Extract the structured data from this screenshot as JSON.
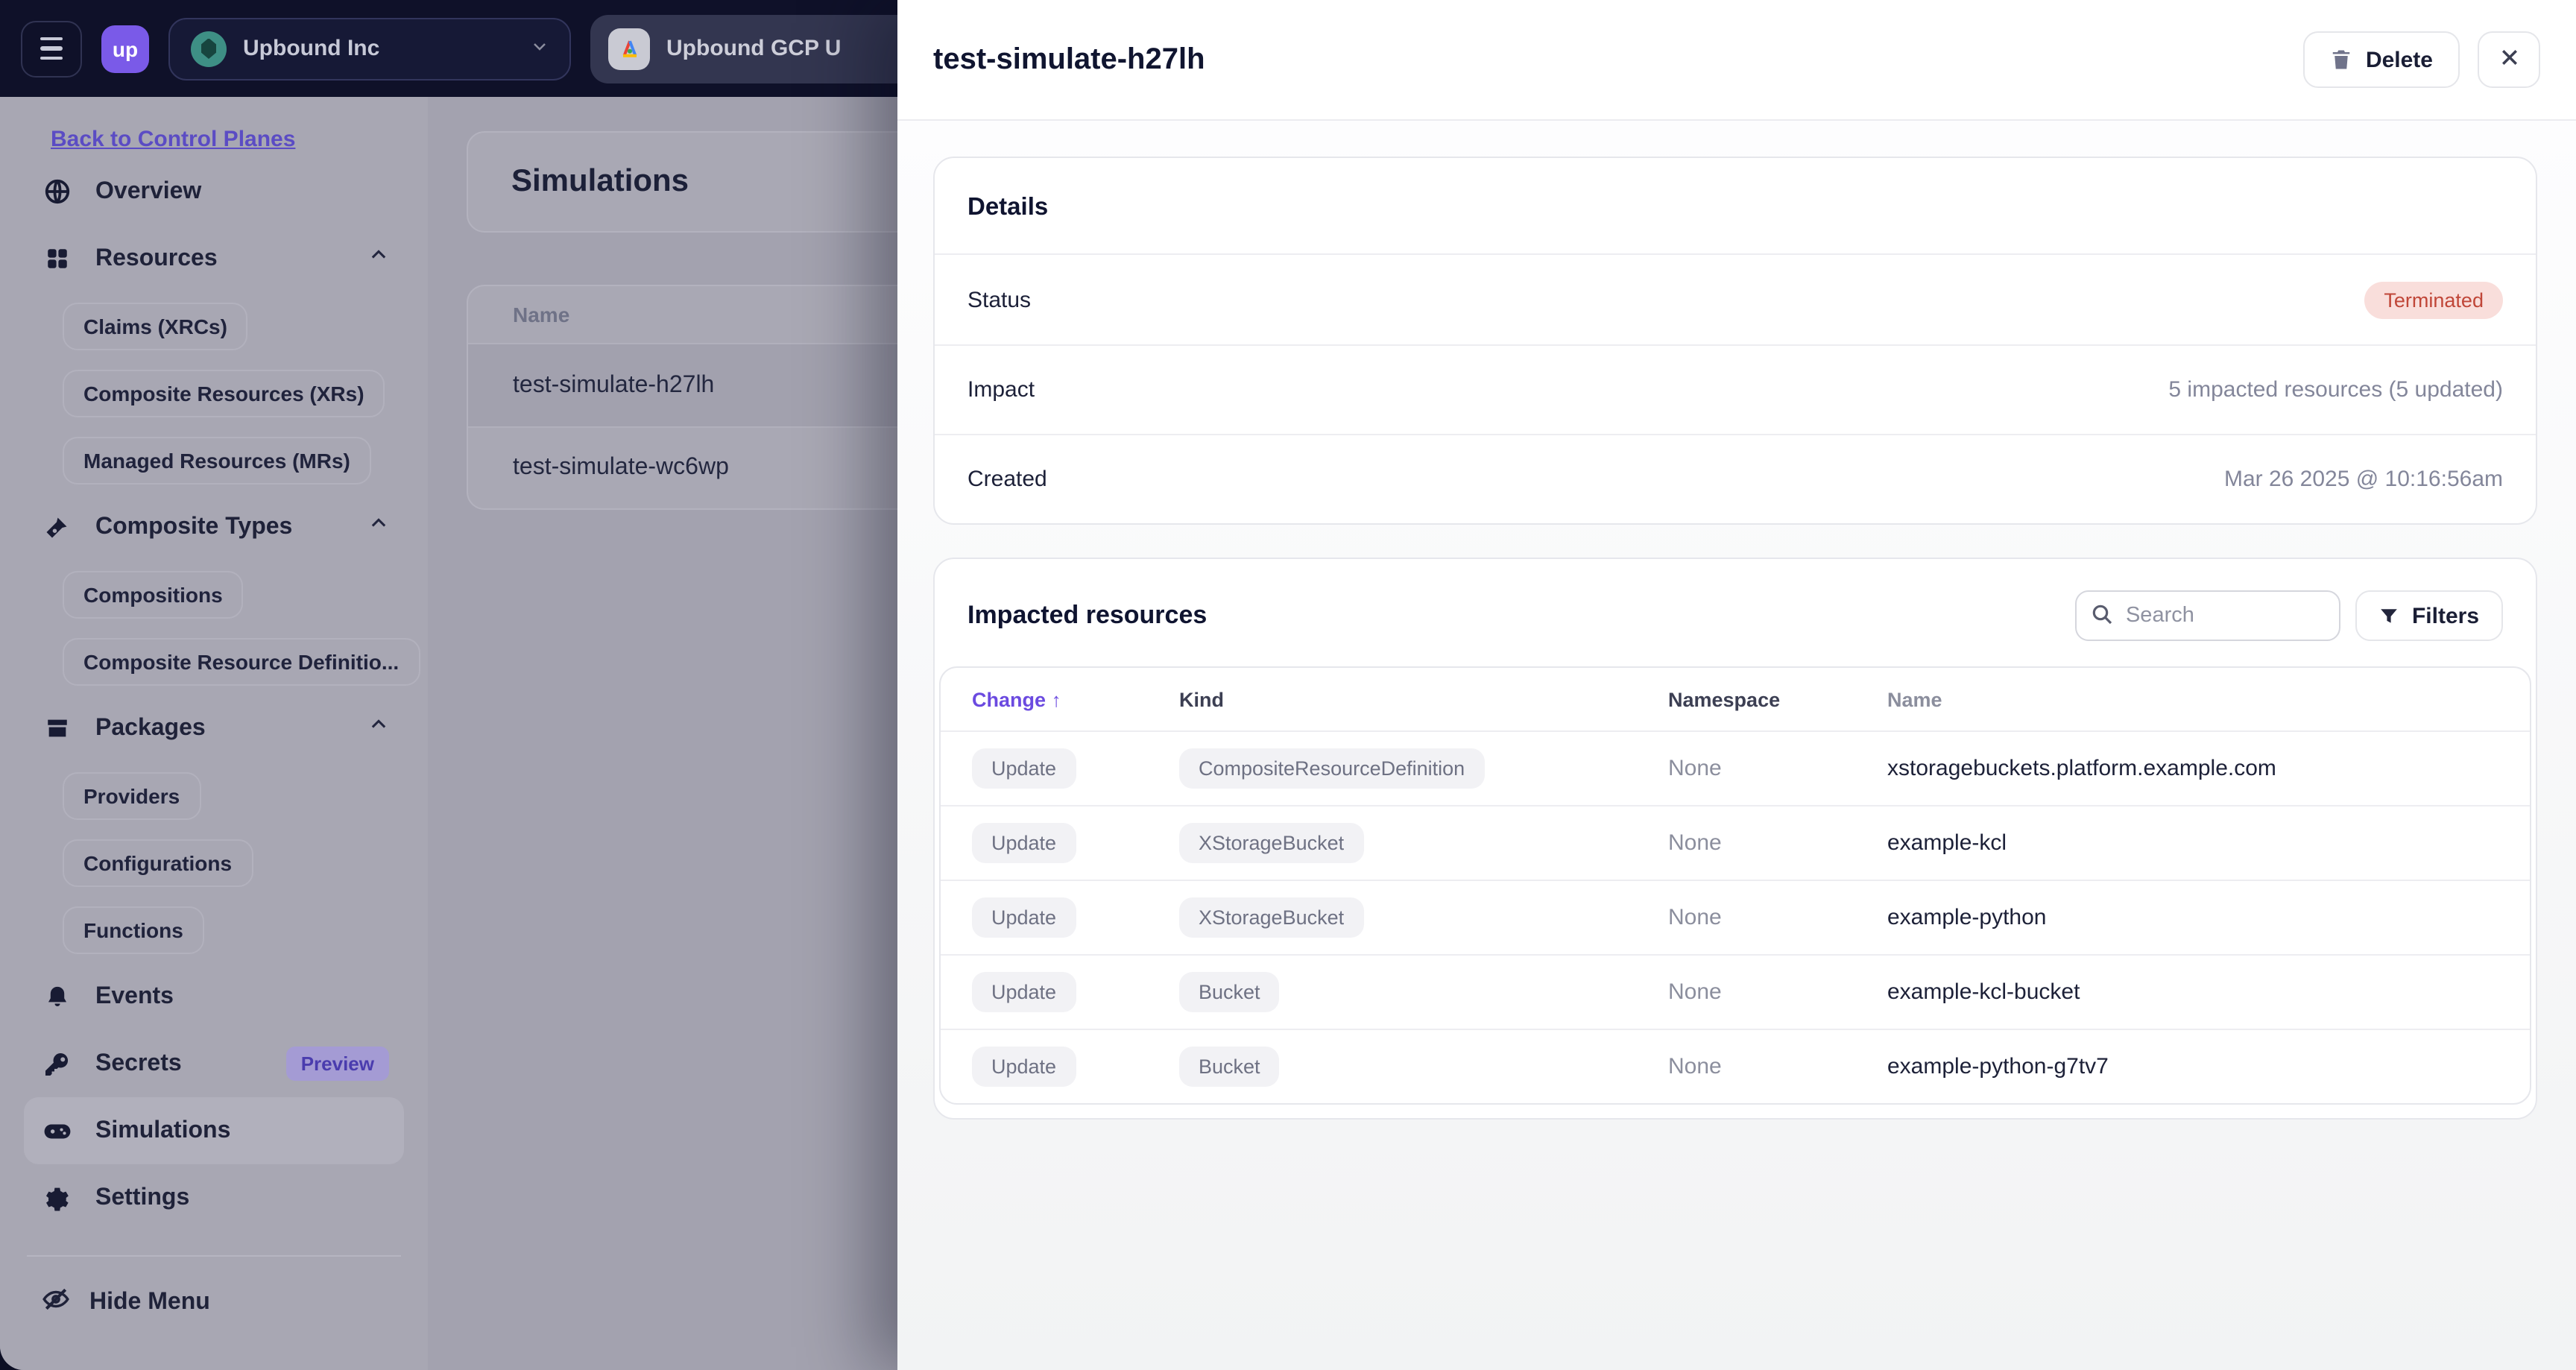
{
  "colors": {
    "accent_purple": "#6b4ae0",
    "brand_purple": "#7a5ae8",
    "status_terminated_bg": "#f9dedb",
    "status_terminated_text": "#c04638",
    "topbar_bg": "#0f1129"
  },
  "header": {
    "logo_text": "up",
    "org_selector": {
      "label": "Upbound Inc"
    },
    "workspace_tab": {
      "label": "Upbound GCP U"
    }
  },
  "sidebar": {
    "back_link": "Back to Control Planes",
    "overview": "Overview",
    "groups": [
      {
        "label": "Resources",
        "pills": [
          "Claims (XRCs)",
          "Composite Resources (XRs)",
          "Managed Resources (MRs)"
        ]
      },
      {
        "label": "Composite Types",
        "pills": [
          "Compositions",
          "Composite Resource Definitio..."
        ]
      },
      {
        "label": "Packages",
        "pills": [
          "Providers",
          "Configurations",
          "Functions"
        ]
      }
    ],
    "events": "Events",
    "secrets": "Secrets",
    "secrets_badge": "Preview",
    "simulations": "Simulations",
    "settings": "Settings",
    "hide_menu": "Hide Menu"
  },
  "main": {
    "title": "Simulations",
    "table": {
      "name_header": "Name",
      "rows": [
        "test-simulate-h27lh",
        "test-simulate-wc6wp"
      ]
    }
  },
  "panel": {
    "title": "test-simulate-h27lh",
    "delete_button": "Delete",
    "details": {
      "title": "Details",
      "status_label": "Status",
      "status_value": "Terminated",
      "impact_label": "Impact",
      "impact_value": "5 impacted resources (5 updated)",
      "created_label": "Created",
      "created_value": "Mar 26 2025 @ 10:16:56am"
    },
    "impacted": {
      "title": "Impacted resources",
      "search_placeholder": "Search",
      "filters_button": "Filters",
      "columns": {
        "change": "Change",
        "sort_arrow": "↑",
        "kind": "Kind",
        "namespace": "Namespace",
        "name": "Name"
      },
      "rows": [
        {
          "change": "Update",
          "kind": "CompositeResourceDefinition",
          "namespace": "None",
          "name": "xstoragebuckets.platform.example.com"
        },
        {
          "change": "Update",
          "kind": "XStorageBucket",
          "namespace": "None",
          "name": "example-kcl"
        },
        {
          "change": "Update",
          "kind": "XStorageBucket",
          "namespace": "None",
          "name": "example-python"
        },
        {
          "change": "Update",
          "kind": "Bucket",
          "namespace": "None",
          "name": "example-kcl-bucket"
        },
        {
          "change": "Update",
          "kind": "Bucket",
          "namespace": "None",
          "name": "example-python-g7tv7"
        }
      ]
    }
  }
}
